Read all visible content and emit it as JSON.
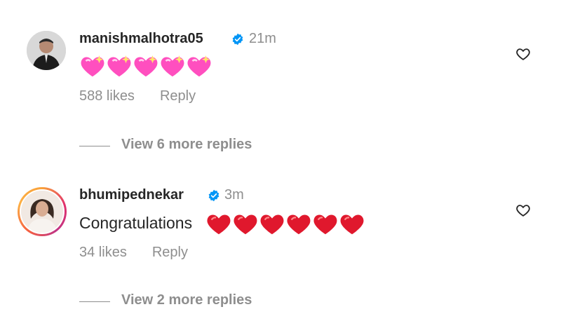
{
  "comments": [
    {
      "username": "manishmalhotra05",
      "verified": true,
      "time": "21m",
      "text": "",
      "emojis": [
        "sparkling-heart",
        "sparkling-heart",
        "sparkling-heart",
        "sparkling-heart",
        "sparkling-heart"
      ],
      "likes": "588 likes",
      "reply_label": "Reply",
      "view_more": "View 6 more replies",
      "avatar_icon": "avatar-photo-icon"
    },
    {
      "username": "bhumipednekar",
      "verified": true,
      "time": "3m",
      "text": "Congratulations",
      "emojis": [
        "red-heart",
        "red-heart",
        "red-heart",
        "red-heart",
        "red-heart",
        "red-heart"
      ],
      "likes": "34 likes",
      "reply_label": "Reply",
      "view_more": "View 2 more replies",
      "avatar_icon": "avatar-photo-icon"
    }
  ],
  "colors": {
    "text": "#262626",
    "secondary": "#8e8e8e",
    "verified": "#0095f6",
    "sparkle_heart": "#ff4fbf",
    "red_heart": "#e0182d"
  }
}
